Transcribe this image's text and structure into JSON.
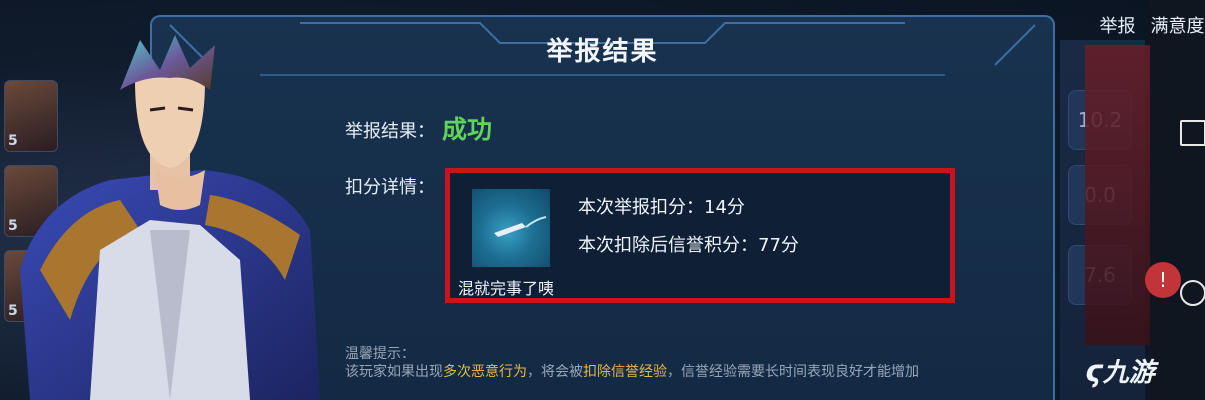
{
  "dialog": {
    "title": "举报结果",
    "result_label": "举报结果：",
    "result_value": "成功",
    "detail_label": "扣分详情：",
    "detail": {
      "caption": "混就完事了咦",
      "deduction": "本次举报扣分：14分",
      "remaining": "本次扣除后信誉积分：77分"
    },
    "tips": {
      "title": "温馨提示：",
      "part1": "该玩家如果出现",
      "highlight1": "多次恶意行为",
      "part2": "，将会被",
      "highlight2": "扣除信誉经验",
      "part3": "，信誉经验需要长时间表现良好才能增加"
    }
  },
  "top_buttons": {
    "report": "举报",
    "satisfied": "满意度"
  },
  "left_strip": {
    "levels": [
      "5",
      "5",
      "5"
    ]
  },
  "right_panel": {
    "values": [
      "10.2",
      "0.0",
      "7.6"
    ]
  },
  "watermark": "九游",
  "colors": {
    "success": "#5fd35a",
    "highlight": "#e7b849",
    "box_border": "#c8141c"
  }
}
